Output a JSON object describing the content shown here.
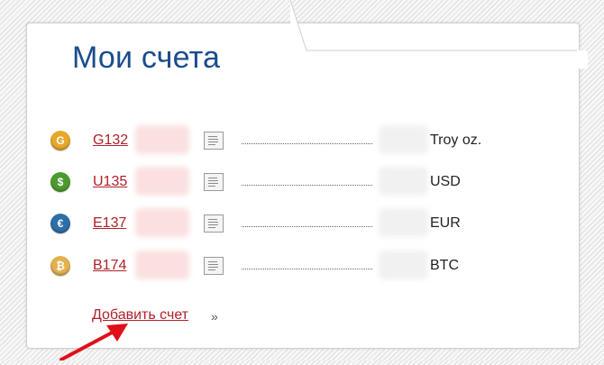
{
  "title": "Мои счета",
  "accounts": [
    {
      "prefix": "G132",
      "currency": "Troy oz.",
      "icon": "gold-coin-icon",
      "symbol": "G",
      "color": "#e7a72a"
    },
    {
      "prefix": "U135",
      "currency": "USD",
      "icon": "dollar-coin-icon",
      "symbol": "$",
      "color": "#4d9b2e"
    },
    {
      "prefix": "E137",
      "currency": "EUR",
      "icon": "euro-coin-icon",
      "symbol": "€",
      "color": "#2f6fa7"
    },
    {
      "prefix": "B174",
      "currency": "BTC",
      "icon": "bitcoin-coin-icon",
      "symbol": "₿",
      "color": "#e3b14f"
    }
  ],
  "add_account": {
    "label": "Добавить счет",
    "suffix": "»"
  },
  "colors": {
    "title": "#1a4c8d",
    "link": "#b0212a",
    "arrow": "#e0101a"
  }
}
